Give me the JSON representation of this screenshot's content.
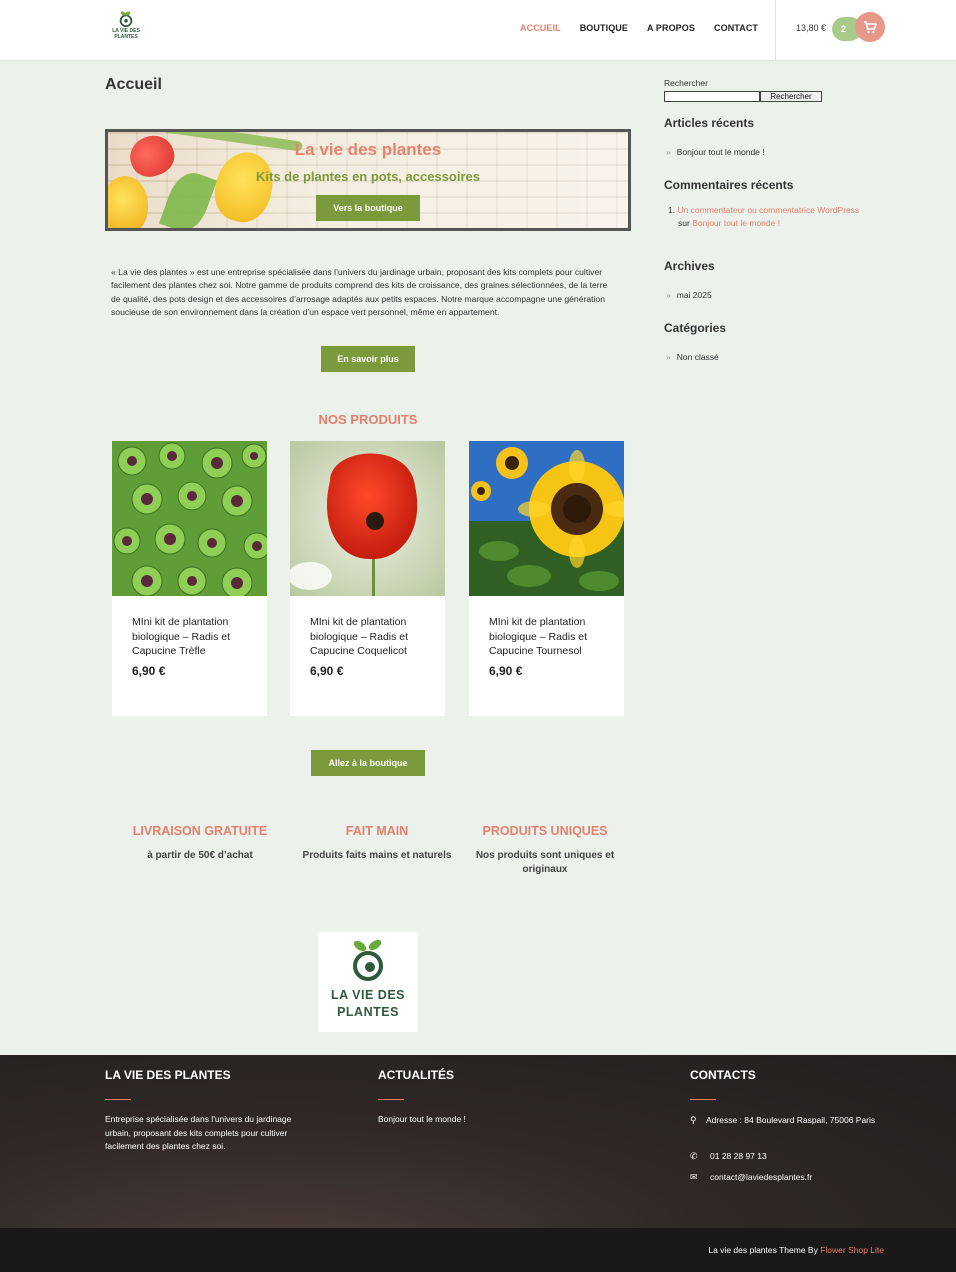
{
  "header": {
    "logo_text": "LA VIE DES PLANTES",
    "nav": [
      "ACCUEIL",
      "BOUTIQUE",
      "A PROPOS",
      "CONTACT"
    ],
    "cart_total": "13,80 €",
    "cart_count": "2"
  },
  "main": {
    "page_title": "Accueil",
    "banner": {
      "title": "La vie des plantes",
      "subtitle": "Kits de plantes en pots, accessoires",
      "button": "Vers la boutique"
    },
    "intro": "« La vie des plantes » est une entreprise spécialisée dans l’univers du jardinage urbain, proposant des kits complets pour cultiver facilement des plantes chez soi. Notre gamme de produits comprend des kits de croissance, des graines sélectionnées, de la terre de qualité, des pots design et des accessoires d’arrosage adaptés aux petits espaces. Notre marque accompagne une génération soucieuse de son environnement dans la création d’un espace vert personnel, même en appartement.",
    "more_button": "En savoir plus",
    "products_title": "NOS PRODUITS",
    "products": [
      {
        "name": "MIni kit de plantation biologique – Radis et Capucine Trèfle",
        "price": "6,90 €",
        "image": "clover"
      },
      {
        "name": "MIni kit de plantation biologique – Radis et Capucine Coquelicot",
        "price": "6,90 €",
        "image": "poppy"
      },
      {
        "name": "MIni kit de plantation biologique – Radis et Capucine Tournesol",
        "price": "6,90 €",
        "image": "sunflower"
      }
    ],
    "shop_button": "Allez à la boutique",
    "features": [
      {
        "title": "LIVRAISON GRATUITE",
        "desc": "à partir de 50€ d’achat"
      },
      {
        "title": "FAIT MAIN",
        "desc": "Produits faits mains et naturels"
      },
      {
        "title": "PRODUITS UNIQUES",
        "desc": "Nos produits sont uniques et originaux"
      }
    ],
    "logo_text": "LA VIE DES PLANTES"
  },
  "sidebar": {
    "search_label": "Rechercher",
    "search_button": "Rechercher",
    "recent_posts_title": "Articles récents",
    "recent_posts": [
      "Bonjour tout le monde !"
    ],
    "recent_comments_title": "Commentaires récents",
    "comment_author": "Un commentateur ou commentatrice WordPress",
    "comment_on": "sur",
    "comment_post": "Bonjour tout le monde !",
    "archives_title": "Archives",
    "archives": [
      "mai 2025"
    ],
    "categories_title": "Catégories",
    "categories": [
      "Non classé"
    ]
  },
  "footer": {
    "col1_title": "LA VIE DES PLANTES",
    "col1_text": "Entreprise spécialisée dans l'univers du jardinage urbain, proposant des kits complets pour cultiver facilement des plantes chez soi.",
    "col2_title": "ACTUALITÉS",
    "col2_link": "Bonjour tout le monde !",
    "col3_title": "CONTACTS",
    "address": "Adresse : 84 Boulevard Raspail, 75006 Paris",
    "phone": "01 28 28 97 13",
    "email": "contact@laviedesplantes.fr",
    "credit_prefix": "La vie des plantes Theme By",
    "credit_link": "Flower Shop Lite"
  },
  "colors": {
    "accent_pink": "#e4806d",
    "accent_green": "#7a9a3c",
    "background": "#ecf1ec"
  }
}
